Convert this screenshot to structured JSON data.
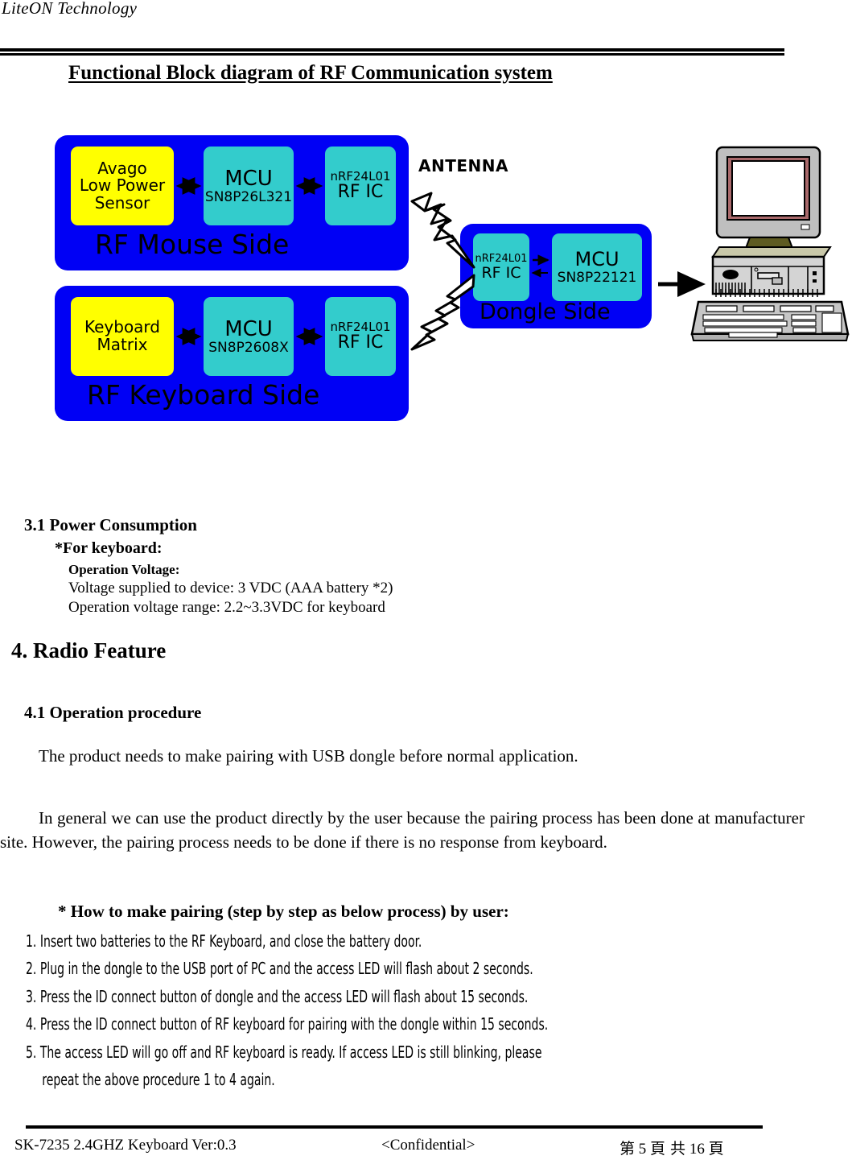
{
  "header": {
    "company": "LiteON Technology",
    "doc_title": "Functional Block diagram of RF Communication system"
  },
  "diagram": {
    "antenna_label": "ANTENNA",
    "mouse_side": {
      "caption": "RF Mouse Side",
      "sensor": {
        "line1": "Avago",
        "line2": "Low Power",
        "line3": "Sensor"
      },
      "mcu": {
        "line1": "MCU",
        "line2": "SN8P26L321"
      },
      "rf": {
        "line1": "nRF24L01",
        "line2": "RF IC"
      }
    },
    "keyboard_side": {
      "caption": "RF Keyboard Side",
      "matrix": {
        "line1": "Keyboard",
        "line2": "Matrix"
      },
      "mcu": {
        "line1": "MCU",
        "line2": "SN8P2608X"
      },
      "rf": {
        "line1": "nRF24L01",
        "line2": "RF IC"
      }
    },
    "dongle_side": {
      "caption": "Dongle Side",
      "rf": {
        "line1": "nRF24L01",
        "line2": "RF IC"
      },
      "mcu": {
        "line1": "MCU",
        "line2": "SN8P22121"
      }
    },
    "colors": {
      "panel_blue": "#0000F5",
      "chip_yellow": "#FFFF00",
      "chip_cyan": "#33CCCC"
    }
  },
  "body": {
    "section_3_1_title": "3.1 Power Consumption",
    "for_keyboard": "*For keyboard:",
    "operation_voltage_label": "Operation Voltage:",
    "voltage_supplied": "Voltage supplied to device: 3 VDC (AAA battery *2)",
    "voltage_range": "Operation voltage range: 2.2~3.3VDC for keyboard",
    "section_4_title": "4. Radio Feature",
    "section_4_1_title": "4.1 Operation procedure",
    "intro_paragraph": "The product needs to make pairing with USB dongle before normal application.",
    "general_paragraph": "In general we can use the product directly by the user because the pairing process has been done at manufacturer site. However, the pairing process needs to be done if there is no response from keyboard.",
    "pairing_heading": "* How to make pairing (step by step as below process) by user:",
    "steps": [
      "1. Insert two batteries to the RF Keyboard, and close the battery door.",
      "2. Plug in the dongle to the USB port of PC and the access LED will flash about 2 seconds.",
      "3. Press the ID connect button of dongle and the access LED will flash about 15 seconds.",
      "4. Press the ID connect button of RF keyboard for pairing with the dongle within 15 seconds.",
      "5. The access LED will go off and RF keyboard is ready. If access LED is still blinking, please"
    ],
    "step_5_continuation": "repeat the above procedure 1 to 4 again."
  },
  "footer": {
    "left": "SK-7235 2.4GHZ Keyboard Ver:0.3",
    "center": "<Confidential>",
    "page_prefix": "第",
    "page_number": "5",
    "page_middle": "頁  共",
    "total_pages": "16",
    "page_suffix": "頁"
  }
}
